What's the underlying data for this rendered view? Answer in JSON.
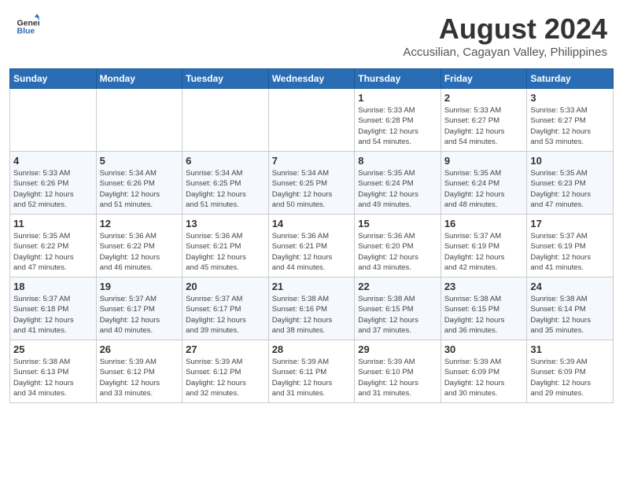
{
  "logo": {
    "line1": "General",
    "line2": "Blue"
  },
  "title": "August 2024",
  "subtitle": "Accusilian, Cagayan Valley, Philippines",
  "days_of_week": [
    "Sunday",
    "Monday",
    "Tuesday",
    "Wednesday",
    "Thursday",
    "Friday",
    "Saturday"
  ],
  "weeks": [
    [
      {
        "day": "",
        "info": ""
      },
      {
        "day": "",
        "info": ""
      },
      {
        "day": "",
        "info": ""
      },
      {
        "day": "",
        "info": ""
      },
      {
        "day": "1",
        "info": "Sunrise: 5:33 AM\nSunset: 6:28 PM\nDaylight: 12 hours\nand 54 minutes."
      },
      {
        "day": "2",
        "info": "Sunrise: 5:33 AM\nSunset: 6:27 PM\nDaylight: 12 hours\nand 54 minutes."
      },
      {
        "day": "3",
        "info": "Sunrise: 5:33 AM\nSunset: 6:27 PM\nDaylight: 12 hours\nand 53 minutes."
      }
    ],
    [
      {
        "day": "4",
        "info": "Sunrise: 5:33 AM\nSunset: 6:26 PM\nDaylight: 12 hours\nand 52 minutes."
      },
      {
        "day": "5",
        "info": "Sunrise: 5:34 AM\nSunset: 6:26 PM\nDaylight: 12 hours\nand 51 minutes."
      },
      {
        "day": "6",
        "info": "Sunrise: 5:34 AM\nSunset: 6:25 PM\nDaylight: 12 hours\nand 51 minutes."
      },
      {
        "day": "7",
        "info": "Sunrise: 5:34 AM\nSunset: 6:25 PM\nDaylight: 12 hours\nand 50 minutes."
      },
      {
        "day": "8",
        "info": "Sunrise: 5:35 AM\nSunset: 6:24 PM\nDaylight: 12 hours\nand 49 minutes."
      },
      {
        "day": "9",
        "info": "Sunrise: 5:35 AM\nSunset: 6:24 PM\nDaylight: 12 hours\nand 48 minutes."
      },
      {
        "day": "10",
        "info": "Sunrise: 5:35 AM\nSunset: 6:23 PM\nDaylight: 12 hours\nand 47 minutes."
      }
    ],
    [
      {
        "day": "11",
        "info": "Sunrise: 5:35 AM\nSunset: 6:22 PM\nDaylight: 12 hours\nand 47 minutes."
      },
      {
        "day": "12",
        "info": "Sunrise: 5:36 AM\nSunset: 6:22 PM\nDaylight: 12 hours\nand 46 minutes."
      },
      {
        "day": "13",
        "info": "Sunrise: 5:36 AM\nSunset: 6:21 PM\nDaylight: 12 hours\nand 45 minutes."
      },
      {
        "day": "14",
        "info": "Sunrise: 5:36 AM\nSunset: 6:21 PM\nDaylight: 12 hours\nand 44 minutes."
      },
      {
        "day": "15",
        "info": "Sunrise: 5:36 AM\nSunset: 6:20 PM\nDaylight: 12 hours\nand 43 minutes."
      },
      {
        "day": "16",
        "info": "Sunrise: 5:37 AM\nSunset: 6:19 PM\nDaylight: 12 hours\nand 42 minutes."
      },
      {
        "day": "17",
        "info": "Sunrise: 5:37 AM\nSunset: 6:19 PM\nDaylight: 12 hours\nand 41 minutes."
      }
    ],
    [
      {
        "day": "18",
        "info": "Sunrise: 5:37 AM\nSunset: 6:18 PM\nDaylight: 12 hours\nand 41 minutes."
      },
      {
        "day": "19",
        "info": "Sunrise: 5:37 AM\nSunset: 6:17 PM\nDaylight: 12 hours\nand 40 minutes."
      },
      {
        "day": "20",
        "info": "Sunrise: 5:37 AM\nSunset: 6:17 PM\nDaylight: 12 hours\nand 39 minutes."
      },
      {
        "day": "21",
        "info": "Sunrise: 5:38 AM\nSunset: 6:16 PM\nDaylight: 12 hours\nand 38 minutes."
      },
      {
        "day": "22",
        "info": "Sunrise: 5:38 AM\nSunset: 6:15 PM\nDaylight: 12 hours\nand 37 minutes."
      },
      {
        "day": "23",
        "info": "Sunrise: 5:38 AM\nSunset: 6:15 PM\nDaylight: 12 hours\nand 36 minutes."
      },
      {
        "day": "24",
        "info": "Sunrise: 5:38 AM\nSunset: 6:14 PM\nDaylight: 12 hours\nand 35 minutes."
      }
    ],
    [
      {
        "day": "25",
        "info": "Sunrise: 5:38 AM\nSunset: 6:13 PM\nDaylight: 12 hours\nand 34 minutes."
      },
      {
        "day": "26",
        "info": "Sunrise: 5:39 AM\nSunset: 6:12 PM\nDaylight: 12 hours\nand 33 minutes."
      },
      {
        "day": "27",
        "info": "Sunrise: 5:39 AM\nSunset: 6:12 PM\nDaylight: 12 hours\nand 32 minutes."
      },
      {
        "day": "28",
        "info": "Sunrise: 5:39 AM\nSunset: 6:11 PM\nDaylight: 12 hours\nand 31 minutes."
      },
      {
        "day": "29",
        "info": "Sunrise: 5:39 AM\nSunset: 6:10 PM\nDaylight: 12 hours\nand 31 minutes."
      },
      {
        "day": "30",
        "info": "Sunrise: 5:39 AM\nSunset: 6:09 PM\nDaylight: 12 hours\nand 30 minutes."
      },
      {
        "day": "31",
        "info": "Sunrise: 5:39 AM\nSunset: 6:09 PM\nDaylight: 12 hours\nand 29 minutes."
      }
    ]
  ]
}
